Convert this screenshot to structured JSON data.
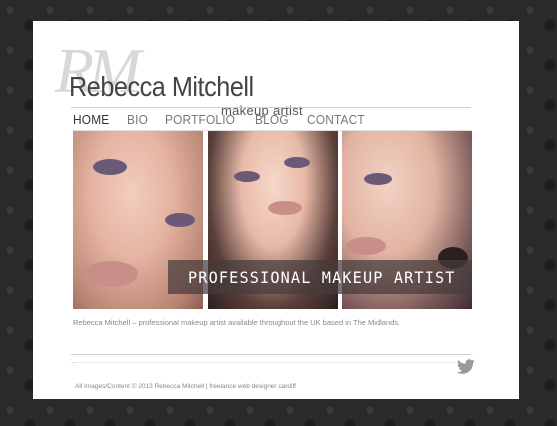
{
  "logo": {
    "monogram": "RM",
    "name": "Rebecca Mitchell",
    "tagline": "makeup artist"
  },
  "nav": {
    "items": [
      {
        "label": "HOME",
        "active": true
      },
      {
        "label": "BIO",
        "active": false
      },
      {
        "label": "PORTFOLIO",
        "active": false
      },
      {
        "label": "BLOG",
        "active": false
      },
      {
        "label": "CONTACT",
        "active": false
      }
    ]
  },
  "hero": {
    "banner_text": "PROFESSIONAL MAKEUP ARTIST"
  },
  "intro": {
    "text": "Rebecca Mitchell – professional makeup artist available throughout the UK based in The Midlands."
  },
  "twitter": {
    "feed_text": ":",
    "icon": "twitter-bird-icon",
    "color": "#9a9a9a"
  },
  "footer": {
    "text": "All Images/Content © 2013 Rebecca Mitchell | freelance web designer cardiff"
  },
  "colors": {
    "background": "#2a2a2a",
    "panel": "#ffffff",
    "banner": "#46403c"
  }
}
